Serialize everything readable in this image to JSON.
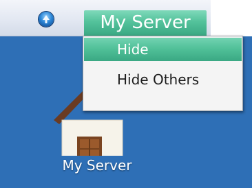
{
  "menubar": {
    "apple_icon": "blue-orb-icon",
    "app_menu_label": "My Server"
  },
  "dropdown": {
    "items": [
      {
        "label": "Hide",
        "highlighted": true
      },
      {
        "label": "Hide Others",
        "highlighted": false
      }
    ]
  },
  "desktop": {
    "background_color": "#2e6fb6",
    "icon": {
      "name": "house-icon",
      "label": "My Server"
    }
  },
  "colors": {
    "accent": "#4fbf97",
    "menubar": "#e3e8f2"
  }
}
